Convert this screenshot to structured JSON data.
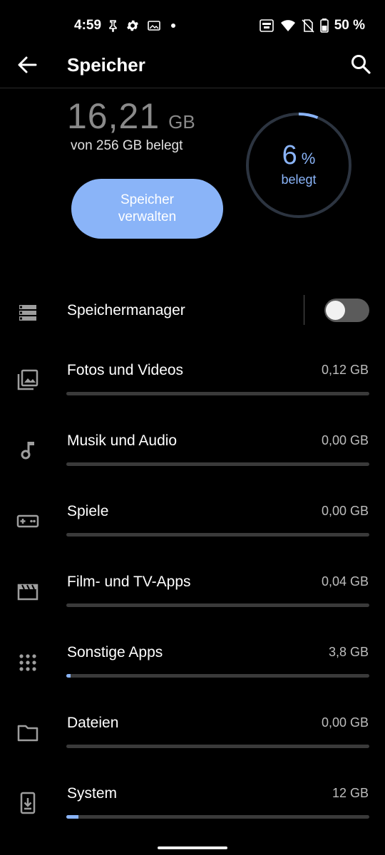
{
  "status_bar": {
    "time": "4:59",
    "battery": "50 %",
    "icons": [
      "notification-bell-icon",
      "settings-gear-icon",
      "image-icon",
      "dot-icon",
      "auto-hz-icon",
      "wifi-icon",
      "no-sim-icon",
      "battery-icon"
    ]
  },
  "app_bar": {
    "title": "Speicher",
    "back_icon": "arrow-back-icon",
    "search_icon": "search-icon"
  },
  "summary": {
    "used_value": "16,21",
    "used_unit": "GB",
    "used_of": "von 256 GB belegt",
    "manage_button": "Speicher verwalten",
    "percent_value": "6",
    "percent_sign": "%",
    "percent_label": "belegt",
    "percent_fraction": 0.06
  },
  "storage_manager": {
    "label": "Speichermanager",
    "icon": "storage-icon",
    "toggle_on": false
  },
  "categories": [
    {
      "label": "Fotos und Videos",
      "size": "0,12 GB",
      "icon": "photo-library-icon",
      "fraction": 0.0
    },
    {
      "label": "Musik und Audio",
      "size": "0,00 GB",
      "icon": "music-note-icon",
      "fraction": 0.0
    },
    {
      "label": "Spiele",
      "size": "0,00 GB",
      "icon": "gamepad-icon",
      "fraction": 0.0
    },
    {
      "label": "Film- und TV-Apps",
      "size": "0,04 GB",
      "icon": "movie-icon",
      "fraction": 0.0
    },
    {
      "label": "Sonstige Apps",
      "size": "3,8 GB",
      "icon": "apps-grid-icon",
      "fraction": 0.015
    },
    {
      "label": "Dateien",
      "size": "0,00 GB",
      "icon": "folder-icon",
      "fraction": 0.0
    },
    {
      "label": "System",
      "size": "12 GB",
      "icon": "system-update-icon",
      "fraction": 0.04
    }
  ],
  "colors": {
    "accent": "#8ab4f8",
    "background": "#000000",
    "track": "#3a3a3a"
  }
}
